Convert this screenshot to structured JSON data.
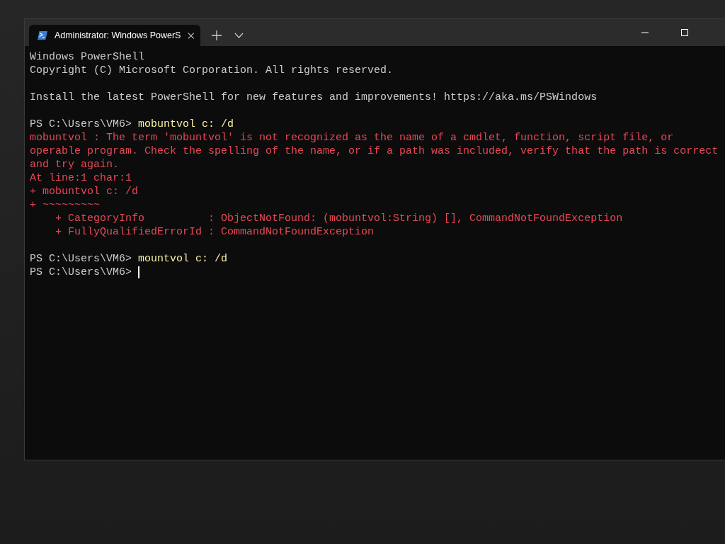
{
  "window": {
    "tab": {
      "title": "Administrator: Windows PowerS",
      "selected": true
    }
  },
  "lines": [
    {
      "kind": "output",
      "text": "Windows PowerShell"
    },
    {
      "kind": "output",
      "text": "Copyright (C) Microsoft Corporation. All rights reserved."
    },
    {
      "kind": "blank"
    },
    {
      "kind": "output",
      "text": "Install the latest PowerShell for new features and improvements! https://aka.ms/PSWindows"
    },
    {
      "kind": "blank"
    },
    {
      "kind": "prompt",
      "prompt": "PS C:\\Users\\VM6>",
      "command": "mobuntvol c: /d",
      "cursor": false
    },
    {
      "kind": "error",
      "text": "mobuntvol : The term 'mobuntvol' is not recognized as the name of a cmdlet, function, script file, or"
    },
    {
      "kind": "error",
      "text": "operable program. Check the spelling of the name, or if a path was included, verify that the path is correct"
    },
    {
      "kind": "error",
      "text": "and try again."
    },
    {
      "kind": "error",
      "text": "At line:1 char:1"
    },
    {
      "kind": "error",
      "text": "+ mobuntvol c: /d"
    },
    {
      "kind": "error",
      "text": "+ ~~~~~~~~~"
    },
    {
      "kind": "error",
      "text": "    + CategoryInfo          : ObjectNotFound: (mobuntvol:String) [], CommandNotFoundException"
    },
    {
      "kind": "error",
      "text": "    + FullyQualifiedErrorId : CommandNotFoundException"
    },
    {
      "kind": "blank"
    },
    {
      "kind": "prompt",
      "prompt": "PS C:\\Users\\VM6>",
      "command": "mountvol c: /d",
      "cursor": false
    },
    {
      "kind": "prompt",
      "prompt": "PS C:\\Users\\VM6>",
      "cursor": true
    }
  ]
}
